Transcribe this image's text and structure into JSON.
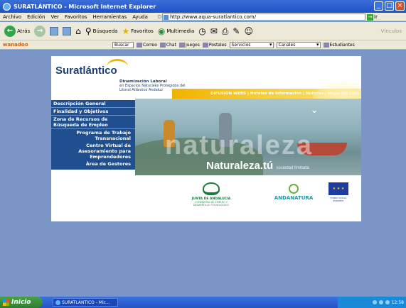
{
  "window": {
    "title": "SURATLÁNTICO - Microsoft Internet Explorer"
  },
  "menubar": {
    "items": [
      "Archivo",
      "Edición",
      "Ver",
      "Favoritos",
      "Herramientas",
      "Ayuda"
    ],
    "address_label": "Dirección",
    "address_value": "http://www.aqua-suratlantico.com/",
    "go_label": "Ir"
  },
  "toolbar": {
    "back_label": "Atrás",
    "search_label": "Búsqueda",
    "favorites_label": "Favoritos",
    "multimedia_label": "Multimedia",
    "links_label": "Vínculos"
  },
  "partner_bar": {
    "brand": "wanadoo",
    "search_button": "Buscar",
    "items": [
      "Correo",
      "Chat",
      "Juegos",
      "Postales"
    ],
    "select1": "Servicios",
    "select2": "Canales",
    "right_text": "Estudiantes"
  },
  "page": {
    "logo_text": "Suratlántico",
    "tagline_bold": "Dinamización Laboral",
    "tagline_rest": "en Espacios Naturales Protegidos del Litoral Atlántico Andaluz",
    "top_links": "DIFUSION WEBS | Hoteles de Información | Noticias | Mapa del Sitio",
    "menu": [
      {
        "label": "Descripción General",
        "sub": false
      },
      {
        "label": "Finalidad y Objetivos",
        "sub": false
      },
      {
        "label": "Zona de Recursos de Búsqueda de Empleo",
        "sub": false
      },
      {
        "label": "Programa de Trabajo Transnacional",
        "sub": true
      },
      {
        "label": "Centro Virtual de Asesoramiento para Emprendedores",
        "sub": true
      },
      {
        "label": "Área de Gestores",
        "sub": true
      }
    ],
    "hero_word": "naturaleza",
    "slogan_main": "Naturaleza.tú",
    "slogan_small": "sociedad limitada",
    "logo_junta_1": "JUNTA DE ANDALUCIA",
    "logo_junta_2": "CONSEJERIA DE EMPLEO Y DESARROLLO TECNOLOGICO",
    "logo_andanatura": "ANDANATURA",
    "logo_eu": "FONDO SOCIAL EUROPEO"
  },
  "taskbar": {
    "start_label": "Inicio",
    "task_label": "SURATLÁNTICO - Mic...",
    "clock": "12:58"
  }
}
